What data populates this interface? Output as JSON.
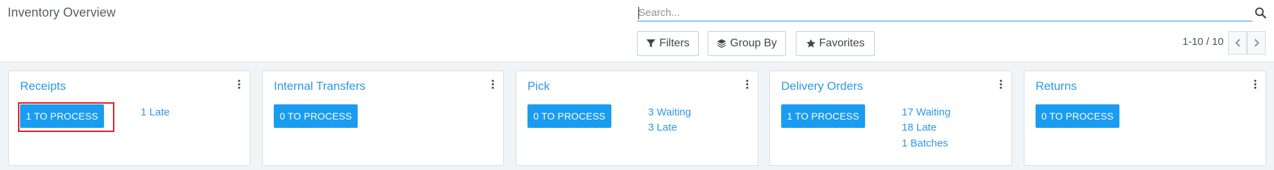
{
  "header": {
    "title": "Inventory Overview",
    "search_placeholder": "Search...",
    "filters_label": "Filters",
    "groupby_label": "Group By",
    "favorites_label": "Favorites",
    "pager_value": "1-10 / 10"
  },
  "cards": [
    {
      "title": "Receipts",
      "process_label": "1 TO PROCESS",
      "links": [
        "1 Late"
      ]
    },
    {
      "title": "Internal Transfers",
      "process_label": "0 TO PROCESS",
      "links": []
    },
    {
      "title": "Pick",
      "process_label": "0 TO PROCESS",
      "links": [
        "3 Waiting",
        "3 Late"
      ]
    },
    {
      "title": "Delivery Orders",
      "process_label": "1 TO PROCESS",
      "links": [
        "17 Waiting",
        "18 Late",
        "1 Batches"
      ]
    },
    {
      "title": "Returns",
      "process_label": "0 TO PROCESS",
      "links": []
    }
  ],
  "colors": {
    "accent": "#2c97e6",
    "primary_button": "#1a9cf0",
    "highlight_box": "#e11b1b"
  }
}
